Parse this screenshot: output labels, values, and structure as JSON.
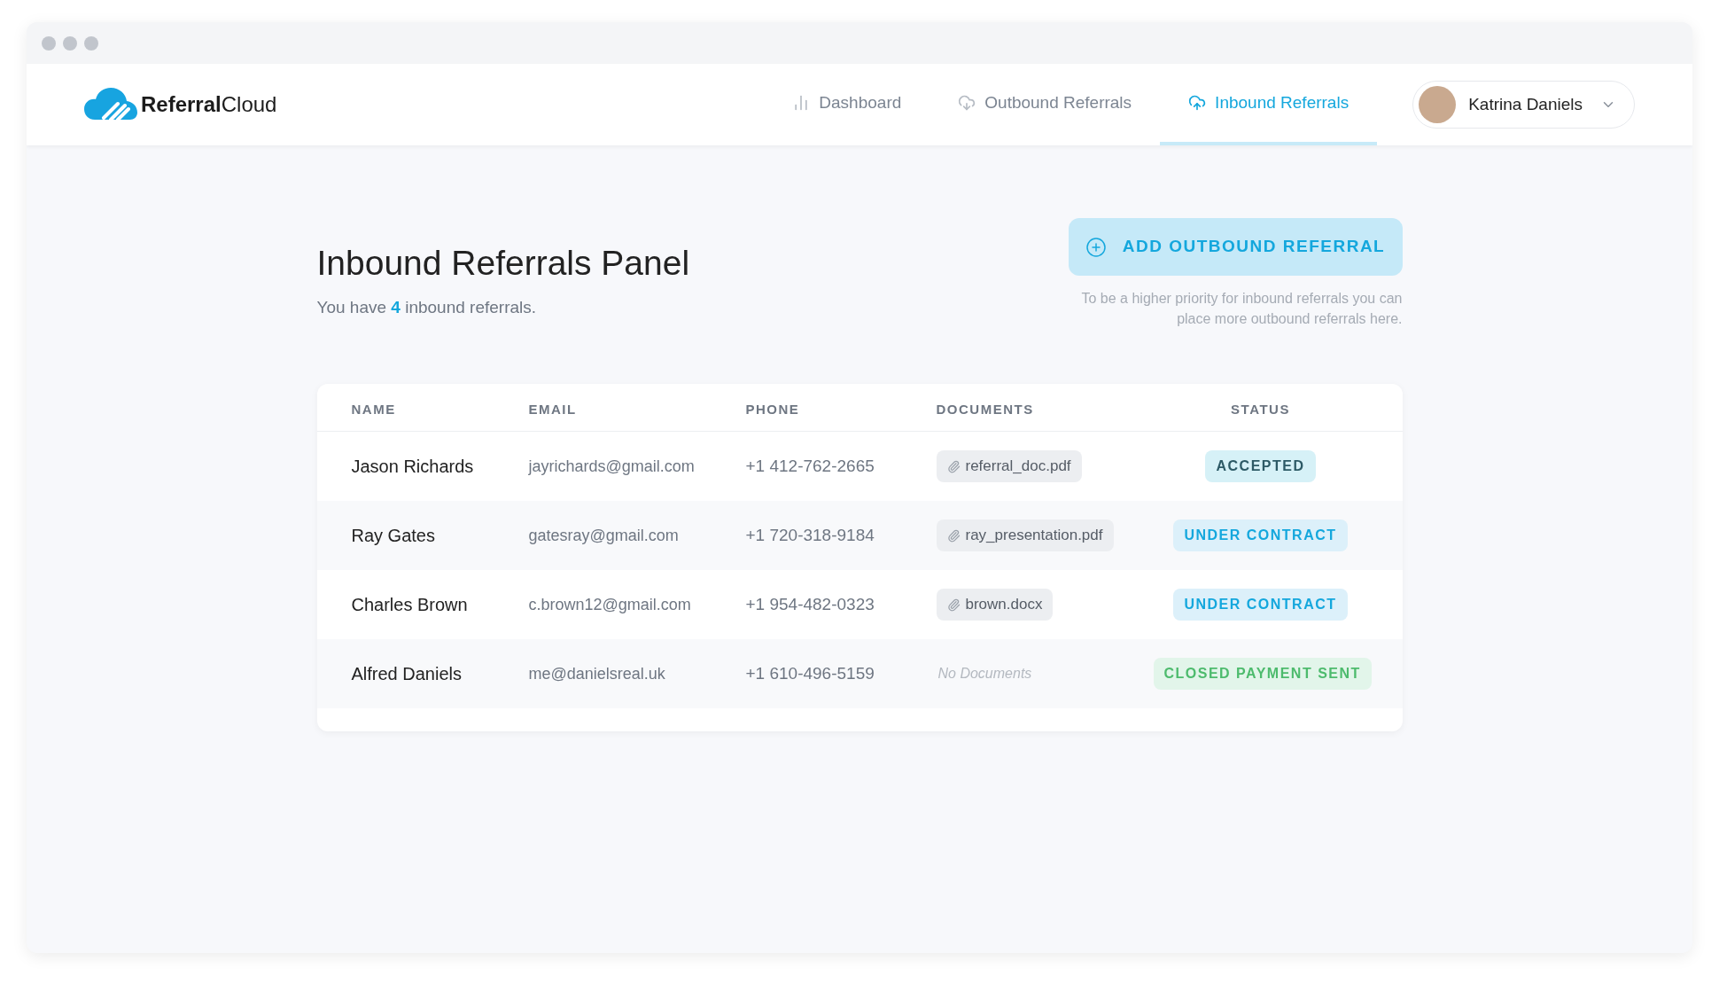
{
  "brand": {
    "bold": "Referral",
    "light": "Cloud"
  },
  "nav": [
    {
      "label": "Dashboard",
      "selected": false
    },
    {
      "label": "Outbound Referrals",
      "selected": false
    },
    {
      "label": "Inbound Referrals",
      "selected": true
    }
  ],
  "user": {
    "name": "Katrina Daniels"
  },
  "panel": {
    "title": "Inbound Referrals Panel",
    "summary": "You have **4** inbound referrals."
  },
  "action": {
    "label": "ADD OUTBOUND REFERRAL",
    "hint": "To be a higher priority for inbound referrals you can place more outbound referrals here."
  },
  "table": {
    "columns": [
      "NAME",
      "EMAIL",
      "PHONE",
      "DOCUMENTS",
      "STATUS"
    ],
    "rows": [
      {
        "name": "Jason Richards",
        "email": "jayrichards@gmail.com",
        "phone": "+1 412-762-2665",
        "document": {
          "kind": "file",
          "label": "referral_doc.pdf"
        },
        "status": {
          "kind": "accepted",
          "label": "ACCEPTED"
        }
      },
      {
        "name": "Ray Gates",
        "email": "gatesray@gmail.com",
        "phone": "+1 720-318-9184",
        "document": {
          "kind": "file",
          "label": "ray_presentation.pdf"
        },
        "status": {
          "kind": "under_contract",
          "label": "UNDER CONTRACT"
        }
      },
      {
        "name": "Charles Brown",
        "email": "c.brown12@gmail.com",
        "phone": "+1 954-482-0323",
        "document": {
          "kind": "file",
          "label": "brown.docx"
        },
        "status": {
          "kind": "under_contract",
          "label": "UNDER CONTRACT"
        }
      },
      {
        "name": "Alfred Daniels",
        "email": "me@danielsreal.uk",
        "phone": "+1 610-496-5159",
        "document": {
          "kind": "none",
          "label": "No Documents"
        },
        "status": {
          "kind": "closed",
          "label": "CLOSED PAYMENT SENT"
        }
      }
    ]
  }
}
